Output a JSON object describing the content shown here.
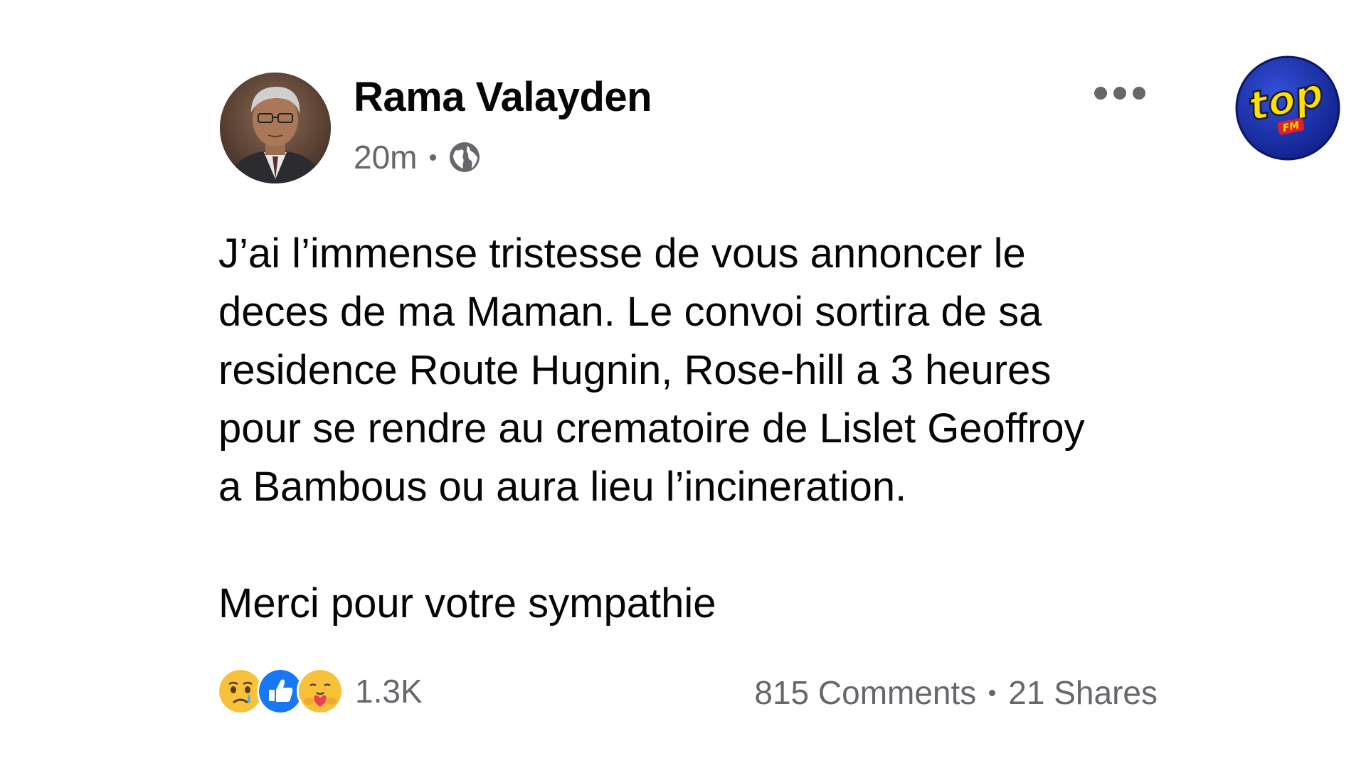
{
  "post": {
    "author_name": "Rama Valayden",
    "timestamp": "20m",
    "audience_icon": "globe-icon",
    "more_icon": "more-dots-icon",
    "lines": [
      "J’ai l’immense tristesse de vous annoncer le",
      "deces de ma Maman. Le convoi sortira de sa",
      "residence Route Hugnin, Rose-hill a 3 heures",
      "pour se rendre au crematoire de Lislet Geoffroy",
      "a Bambous ou aura lieu l’incineration."
    ],
    "closing_line": "Merci pour votre sympathie"
  },
  "footer": {
    "reactions": [
      "sad-reaction-icon",
      "like-reaction-icon",
      "care-reaction-icon"
    ],
    "reaction_count": "1.3K",
    "comments": "815 Comments",
    "shares": "21 Shares"
  },
  "branding": {
    "logo_text": "top",
    "logo_subtext": "FM"
  },
  "colors": {
    "primary_text": "#050505",
    "secondary_text": "#65676b",
    "like_blue": "#1877f2",
    "logo_blue": "#1a2fa0",
    "logo_yellow": "#ffe100"
  }
}
